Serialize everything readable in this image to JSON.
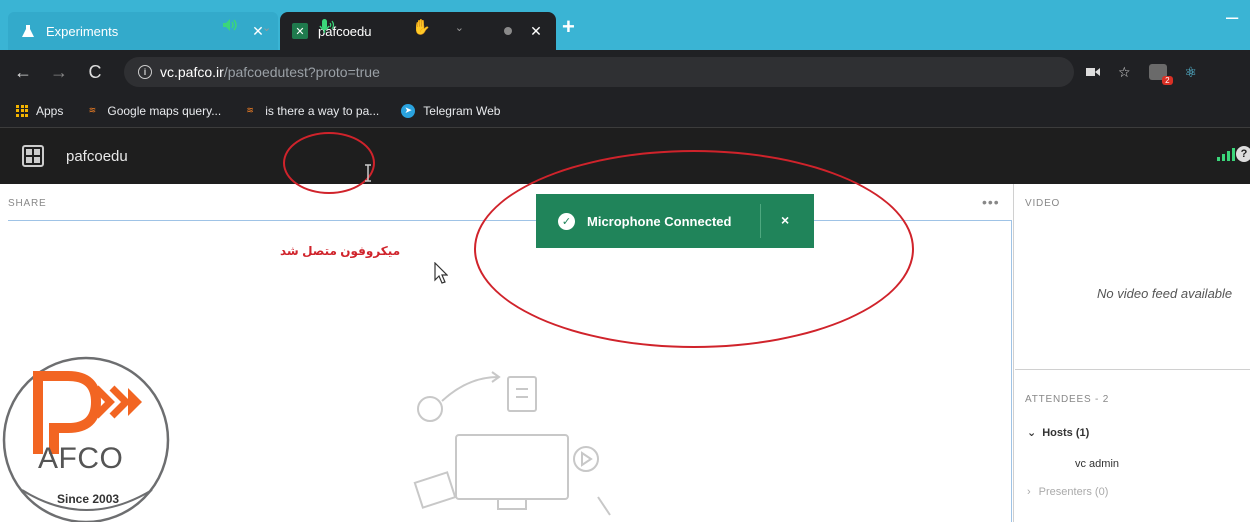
{
  "browser": {
    "tabs": [
      {
        "title": "Experiments",
        "active": false
      },
      {
        "title": "pafcoedu",
        "active": true
      }
    ],
    "new_tab": "+",
    "url_host": "vc.pafco.ir",
    "url_path": "/pafcoedutest?proto=true",
    "extension_badge": "2",
    "bookmarks": [
      {
        "label": "Apps"
      },
      {
        "label": "Google maps query..."
      },
      {
        "label": "is there a way to pa..."
      },
      {
        "label": "Telegram Web"
      }
    ]
  },
  "meeting": {
    "room_name": "pafcoedu",
    "share_header": "SHARE",
    "more_label": "•••",
    "video_header": "VIDEO",
    "no_video_text": "No video feed available",
    "attendees_header": "ATTENDEES - 2",
    "hosts_label": "Hosts (1)",
    "host_name": "vc admin",
    "presenters_label": "Presenters (0)"
  },
  "toast": {
    "message": "Microphone Connected",
    "close": "×"
  },
  "annotation": {
    "persian_text": "میکروفون متصل شد"
  },
  "logo": {
    "brand": "AFCO",
    "since": "Since 2003",
    "colors": {
      "orange": "#f26522",
      "gray": "#6d6e70"
    }
  },
  "colors": {
    "tabstrip": "#3ab4d4",
    "chrome_dark": "#202124",
    "toast_green": "#20845a",
    "annotation_red": "#d0232b"
  }
}
